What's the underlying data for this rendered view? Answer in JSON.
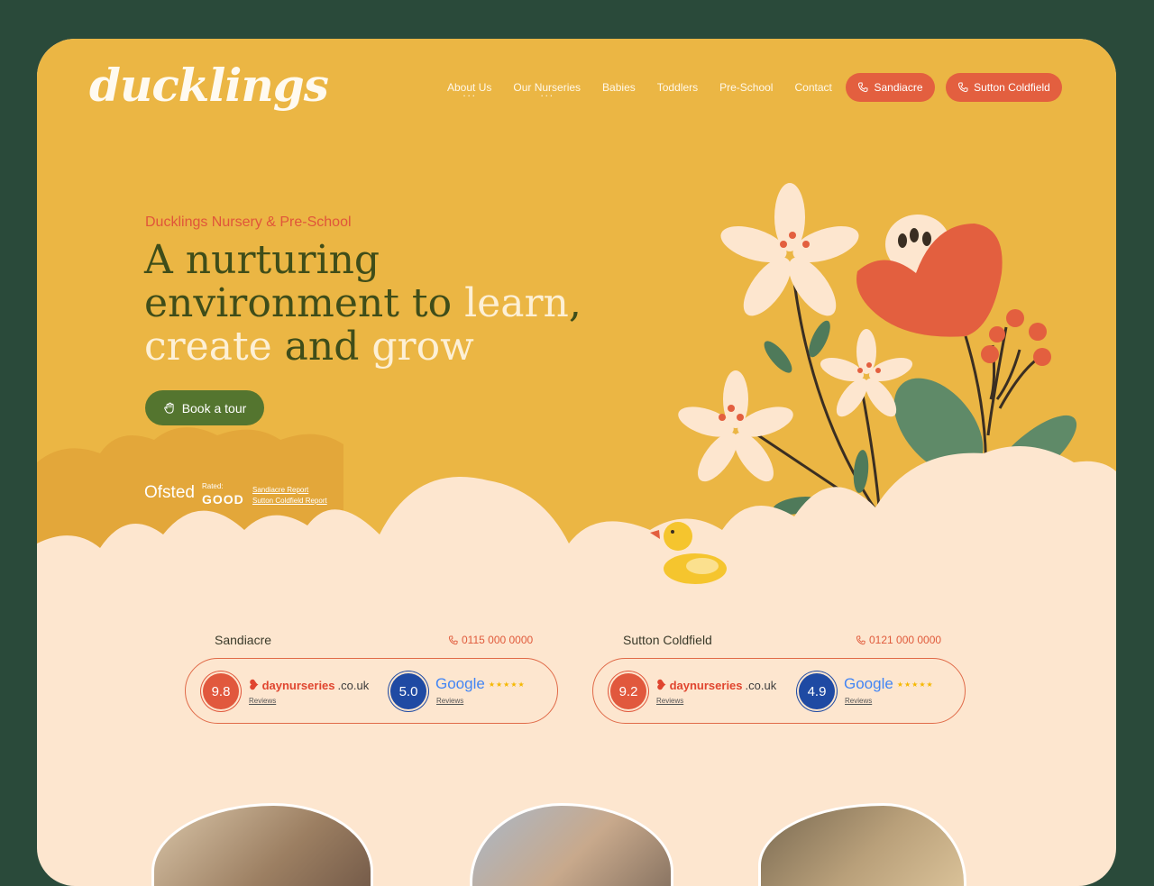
{
  "brand": {
    "logo_text": "ducklings"
  },
  "nav": {
    "items": [
      {
        "label": "About Us",
        "has_submenu": true
      },
      {
        "label": "Our Nurseries",
        "has_submenu": true
      },
      {
        "label": "Babies",
        "has_submenu": false
      },
      {
        "label": "Toddlers",
        "has_submenu": false
      },
      {
        "label": "Pre-School",
        "has_submenu": false
      },
      {
        "label": "Contact",
        "has_submenu": false
      }
    ],
    "call_buttons": [
      {
        "label": "Sandiacre",
        "icon": "phone-icon"
      },
      {
        "label": "Sutton Coldfield",
        "icon": "phone-icon"
      }
    ]
  },
  "hero": {
    "eyebrow": "Ducklings Nursery & Pre-School",
    "headline": {
      "part1": "A nurturing",
      "part2": "environment to ",
      "part3": "learn",
      "part4": ",",
      "part5": "create",
      "part6": " and ",
      "part7": "grow"
    },
    "cta_label": "Book a tour",
    "cta_icon": "hand-wave-icon"
  },
  "ofsted": {
    "logo_text": "Ofsted",
    "rated_label": "Rated:",
    "rating": "GOOD",
    "reports": [
      {
        "label": "Sandiacre Report"
      },
      {
        "label": "Sutton Coldfield Report"
      }
    ]
  },
  "locations": [
    {
      "name": "Sandiacre",
      "phone": "0115 000 0000",
      "daynurseries_score": "9.8",
      "google_score": "5.0",
      "reviews_label": "Reviews"
    },
    {
      "name": "Sutton Coldfield",
      "phone": "0121 000 0000",
      "daynurseries_score": "9.2",
      "google_score": "4.9",
      "reviews_label": "Reviews"
    }
  ],
  "review_brands": {
    "daynurseries_name": "daynurseries",
    "daynurseries_tld": ".co.uk",
    "google_name": "Google",
    "stars": "★★★★★"
  },
  "colors": {
    "page_bg": "#2a4a3a",
    "hero_bg": "#ebb644",
    "cream": "#fde6cf",
    "accent_red": "#e35f3f",
    "olive": "#54752f",
    "headline_dark": "#3f4d19",
    "rating_blue": "#1f4aa3"
  }
}
